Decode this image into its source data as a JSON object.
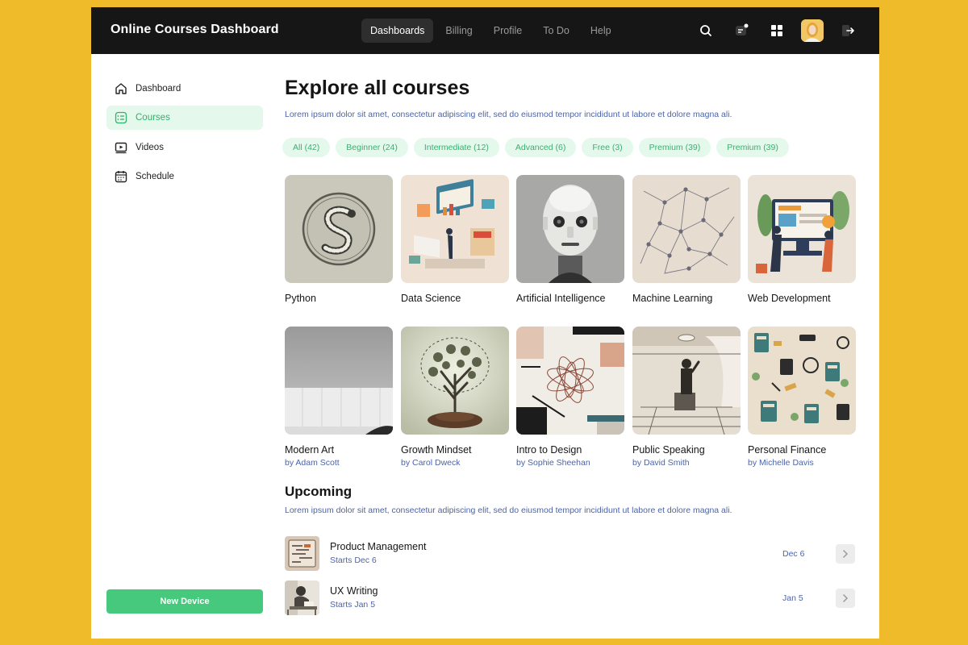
{
  "header": {
    "title": "Online Courses Dashboard",
    "nav": [
      "Dashboards",
      "Billing",
      "Profile",
      "To Do",
      "Help"
    ],
    "active_nav": "Dashboards",
    "icons": [
      "search-icon",
      "notifications-icon",
      "apps-grid-icon",
      "user-avatar",
      "logout-icon"
    ]
  },
  "sidebar": {
    "items": [
      {
        "label": "Dashboard",
        "icon": "home-icon"
      },
      {
        "label": "Courses",
        "icon": "courses-list-icon",
        "active": true
      },
      {
        "label": "Videos",
        "icon": "video-play-icon"
      },
      {
        "label": "Schedule",
        "icon": "calendar-icon"
      }
    ],
    "new_device": "New Device"
  },
  "main": {
    "title": "Explore all courses",
    "description": "Lorem ipsum dolor sit amet, consectetur adipiscing elit, sed do eiusmod  tempor incididunt ut labore et dolore magna ali.",
    "filters": [
      "All (42)",
      "Beginner (24)",
      "Intermediate (12)",
      "Advanced (6)",
      "Free (3)",
      "Premium (39)",
      "Premium (39)"
    ],
    "courses": [
      {
        "title": "Python"
      },
      {
        "title": "Data Science"
      },
      {
        "title": "Artificial Intelligence"
      },
      {
        "title": "Machine Learning"
      },
      {
        "title": "Web Development"
      },
      {
        "title": "Modern Art",
        "author": "by Adam Scott"
      },
      {
        "title": "Growth Mindset",
        "author": "by Carol Dweck"
      },
      {
        "title": "Intro to Design",
        "author": "by Sophie Sheehan"
      },
      {
        "title": "Public Speaking",
        "author": "by David Smith"
      },
      {
        "title": "Personal Finance",
        "author": "by Michelle Davis"
      }
    ]
  },
  "upcoming": {
    "title": "Upcoming",
    "description": "Lorem ipsum dolor sit amet, consectetur adipiscing elit, sed do eiusmod  tempor incididunt ut labore et dolore magna ali.",
    "items": [
      {
        "title": "Product Management",
        "subtitle": "Starts Dec 6",
        "date": "Dec 6"
      },
      {
        "title": "UX Writing",
        "subtitle": "Starts Jan 5",
        "date": "Jan 5"
      }
    ]
  },
  "colors": {
    "accent_green": "#46c97d",
    "chip_bg": "#e4f8ec",
    "link_blue": "#4c64a8",
    "topbar": "#161616",
    "background": "#f0bb2a"
  }
}
